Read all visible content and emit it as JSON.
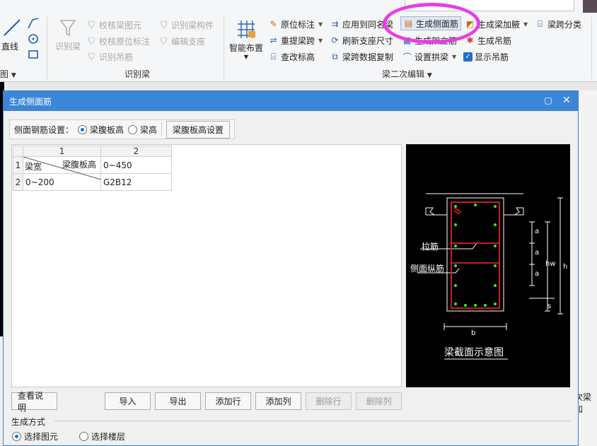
{
  "ribbon": {
    "draw_group": {
      "line_label": "直线",
      "group_label": "图"
    },
    "identify_beam_group": {
      "identify_beam_label": "识别梁",
      "check_beam_element_label": "校核梁图元",
      "identify_beam_member_label": "识别梁构件",
      "check_origin_label": "校核原位标注",
      "edit_support_label": "编辑支座",
      "identify_hanger_label": "识别吊筋",
      "group_label": "识别梁"
    },
    "secondary_edit_group": {
      "smart_layout_label": "智能布置",
      "origin_mark_label": "原位标注",
      "apply_same_name_label": "应用到同名梁",
      "gen_side_rebar_label": "生成侧面筋",
      "gen_haunch_label": "生成梁加腋",
      "beam_span_class_label": "梁跨分类",
      "re_extract_span_label": "重提梁跨",
      "refresh_support_label": "刷新支座尺寸",
      "gen_stirrup_label": "生成架立筋",
      "gen_hanger_label": "生成吊筋",
      "check_elevation_label": "查改标高",
      "copy_span_data_label": "梁跨数据复制",
      "set_arch_label": "设置拱梁",
      "show_hanger_label": "显示吊筋",
      "group_label": "梁二次编辑"
    }
  },
  "dialog": {
    "title": "生成侧面筋",
    "side_rebar_setting_label": "侧面钢筋设置：",
    "option_web_height": "梁腹板高",
    "option_beam_height": "梁高",
    "web_height_setting_button": "梁腹板高设置",
    "table": {
      "col_numbers": [
        "1",
        "2"
      ],
      "corner_top": "梁腹板高",
      "corner_bottom": "梁宽",
      "row_numbers": [
        "1",
        "2"
      ],
      "header_value": "0~450",
      "rows": [
        {
          "width_range": "0~200",
          "rebar": "G2B12"
        }
      ]
    },
    "diagram": {
      "tie_bar_label": "拉筋",
      "side_long_bar_label": "侧面纵筋",
      "caption": "梁截面示意图",
      "dim_a": "a",
      "dim_hw": "hw",
      "dim_h": "h",
      "dim_s": "s",
      "dim_b": "b"
    },
    "buttons": {
      "view_help": "查看说明",
      "import": "导入",
      "export": "导出",
      "add_row": "添加行",
      "add_col": "添加列",
      "delete_row": "删除行",
      "delete_col": "删除列"
    },
    "gen_method_label": "生成方式",
    "option_select_element": "选择图元",
    "option_select_floor": "选择楼层"
  },
  "background": {
    "right_partial_text": "次梁加"
  }
}
